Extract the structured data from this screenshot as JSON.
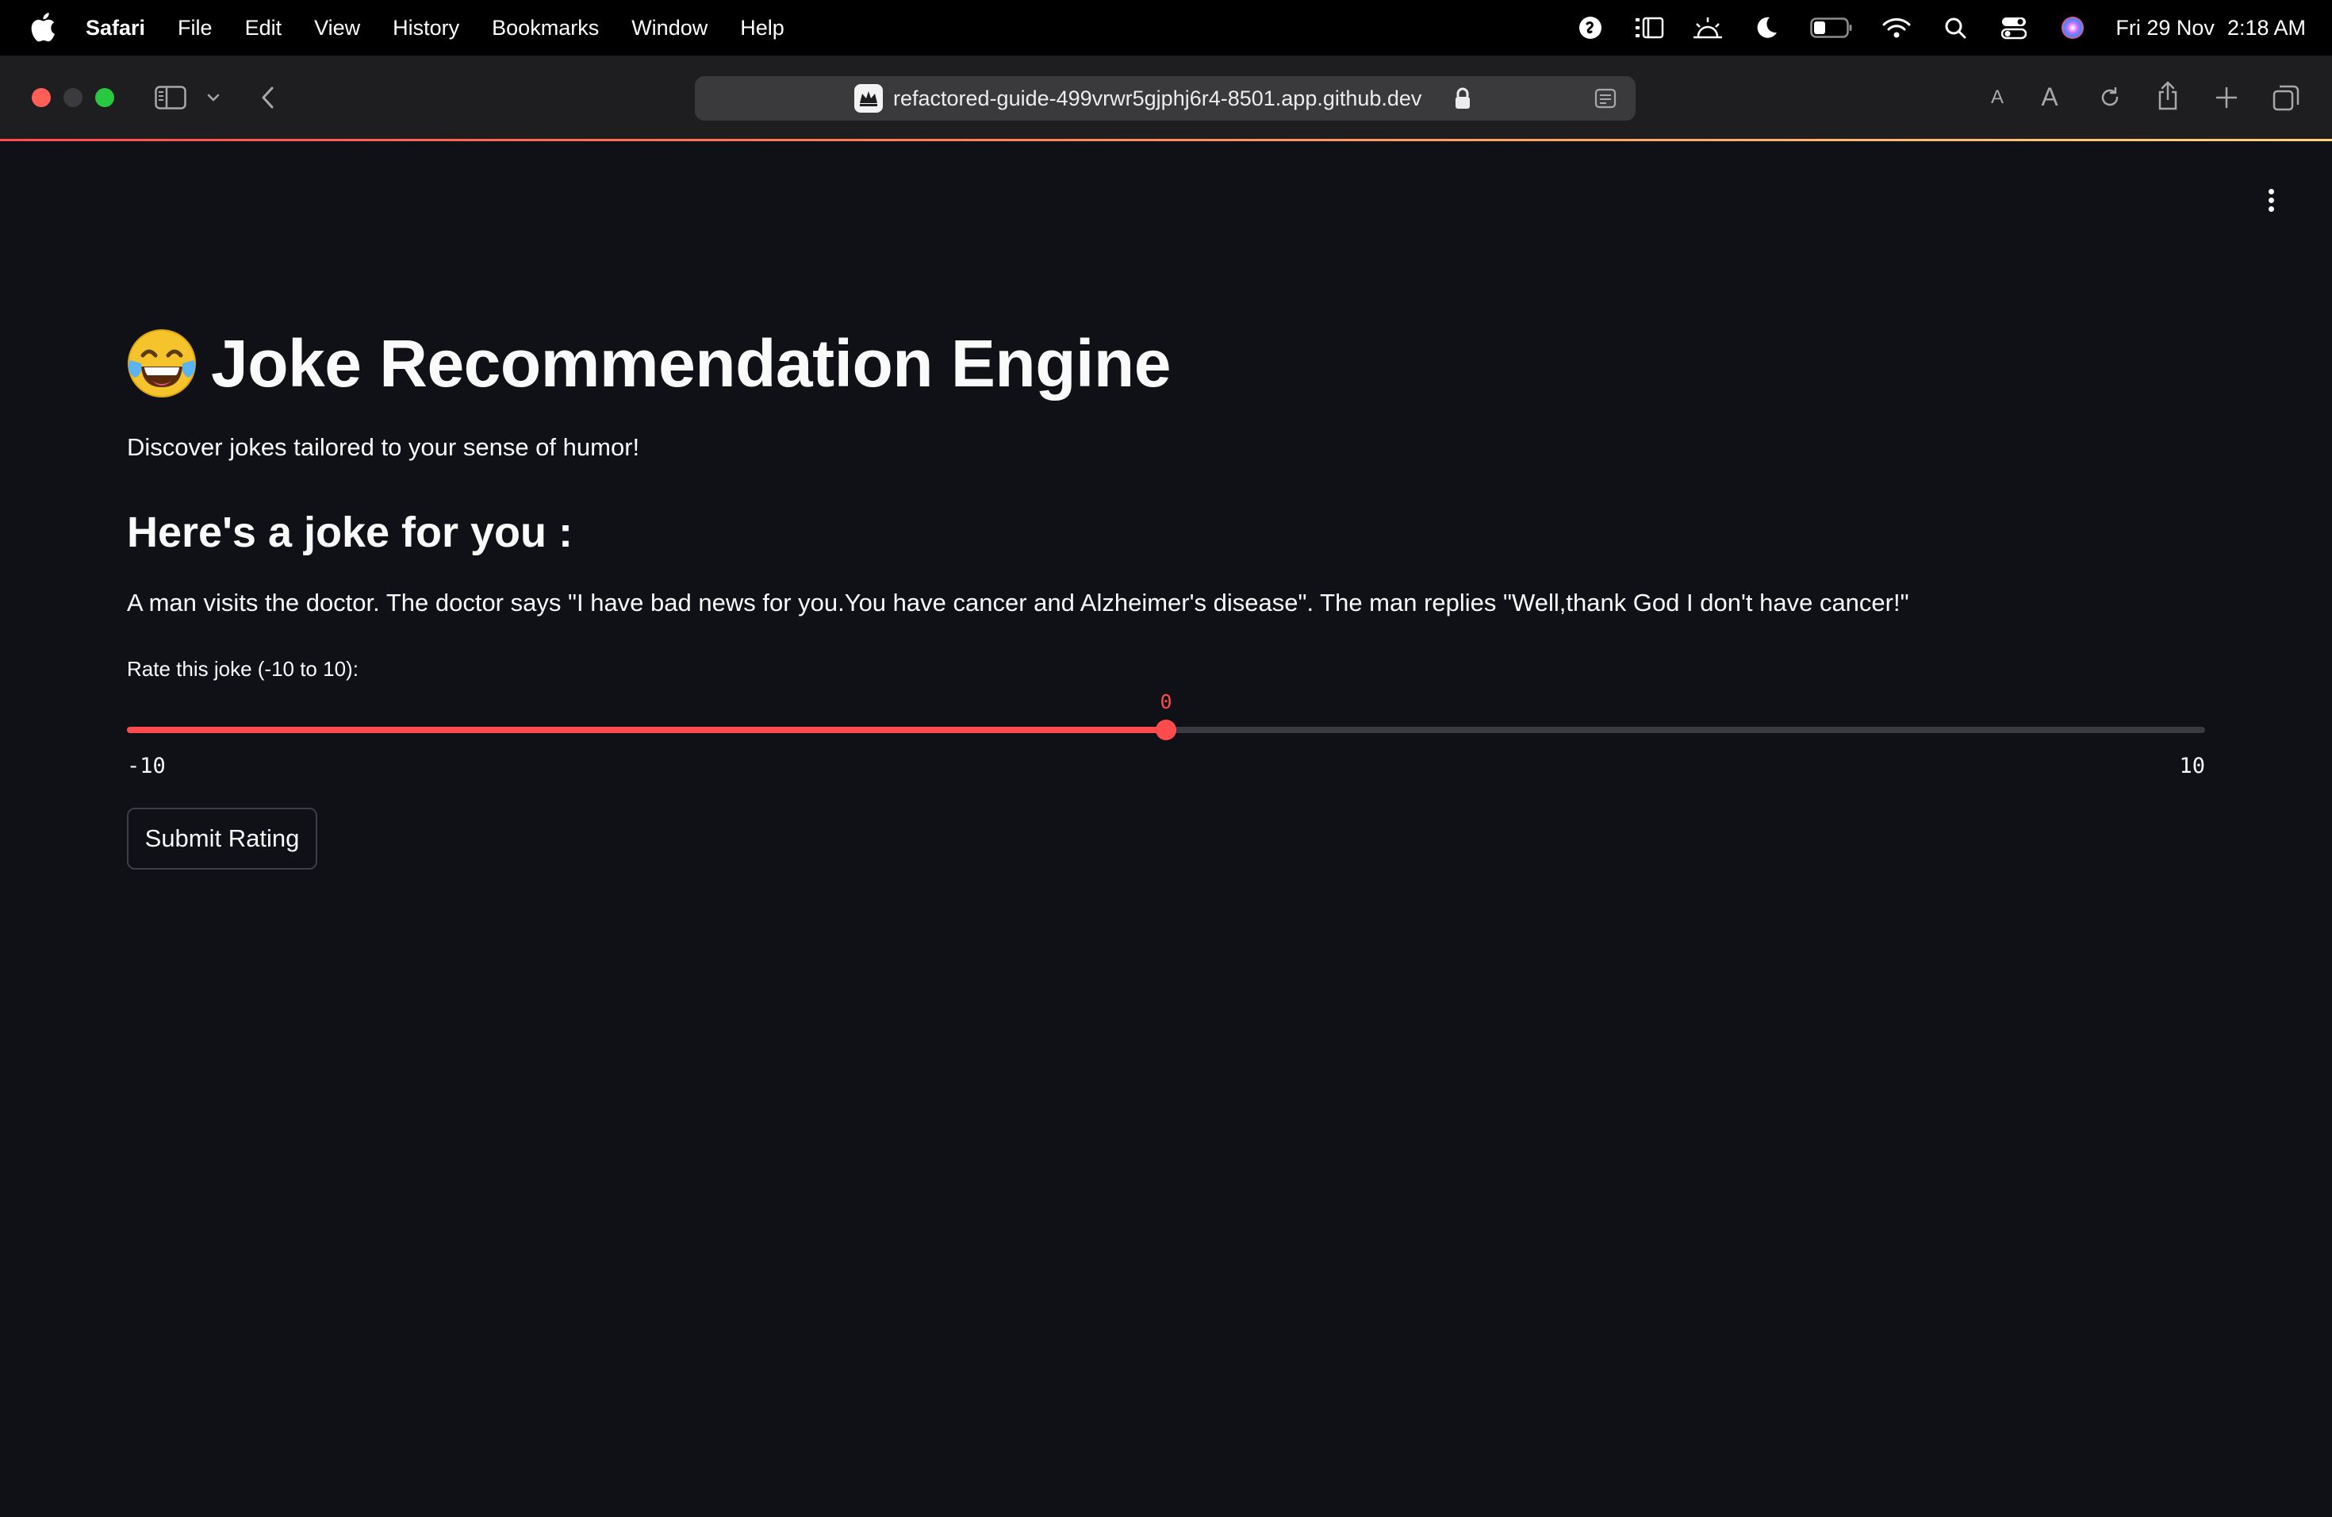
{
  "menubar": {
    "app_name": "Safari",
    "menus": [
      "File",
      "Edit",
      "View",
      "History",
      "Bookmarks",
      "Window",
      "Help"
    ],
    "clock_date": "Fri 29 Nov",
    "clock_time": "2:18 AM"
  },
  "browser": {
    "url": "refactored-guide-499vrwr5gjphj6r4-8501.app.github.dev",
    "text_size_small": "A",
    "text_size_large": "A"
  },
  "app": {
    "emoji": "😂",
    "title": "Joke Recommendation Engine",
    "subtitle": "Discover jokes tailored to your sense of humor!",
    "section_heading": "Here's a joke for you :",
    "joke": "A man visits the doctor. The doctor says \"I have bad news for you.You have cancer and Alzheimer's disease\". The man replies \"Well,thank God I don't have cancer!\""
  },
  "slider": {
    "label": "Rate this joke (-10 to 10):",
    "min": -10,
    "max": 10,
    "value": 0,
    "min_label": "-10",
    "max_label": "10",
    "value_label": "0",
    "accent_color": "#ff4b4b"
  },
  "submit": {
    "label": "Submit Rating"
  },
  "colors": {
    "background": "#0f1117",
    "text": "#fafafa",
    "accent": "#ff4b4b"
  }
}
